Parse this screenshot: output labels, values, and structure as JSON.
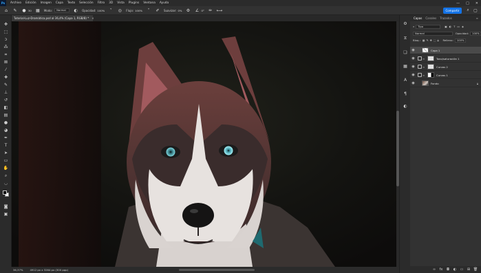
{
  "menubar": {
    "logo": "Ps",
    "items": [
      "Archivo",
      "Edición",
      "Imagen",
      "Capa",
      "Texto",
      "Selección",
      "Filtro",
      "3D",
      "Vista",
      "Plugins",
      "Ventana",
      "Ayuda"
    ],
    "controls": [
      "—",
      "□",
      "✕"
    ]
  },
  "options": {
    "brush_size": "30",
    "mode_label": "Modo:",
    "mode_value": "Normal",
    "opacity_label": "Opacidad:",
    "opacity_value": "100%",
    "flow_label": "Flujo:",
    "flow_value": "100%",
    "smoothing_label": "Suavizar:",
    "smoothing_value": "0%",
    "angle_value": "0°",
    "share_label": "Compartir"
  },
  "document": {
    "tab_title": "Tutorial-Luz-Dramática.psd al 36,4% (Capa 1, RGB/8) *",
    "close": "×",
    "zoom": "36,37%",
    "info": "4912 px x 3264 px (300 ppp)"
  },
  "panel": {
    "tabs": [
      "Capas",
      "Canales",
      "Trazados"
    ],
    "search_value": "Tipo",
    "blend_value": "Normal",
    "opacity_label": "Opacidad:",
    "opacity_value": "100%",
    "lock_label": "Bloq.:",
    "fill_label": "Relleno:",
    "fill_value": "100%",
    "layers": [
      {
        "name": "Capa 1",
        "selected": true
      },
      {
        "name": "Tono/saturación 1",
        "selected": false
      },
      {
        "name": "Curvas 2",
        "selected": false
      },
      {
        "name": "Curvas 1",
        "selected": false
      },
      {
        "name": "Fondo",
        "selected": false
      }
    ]
  }
}
